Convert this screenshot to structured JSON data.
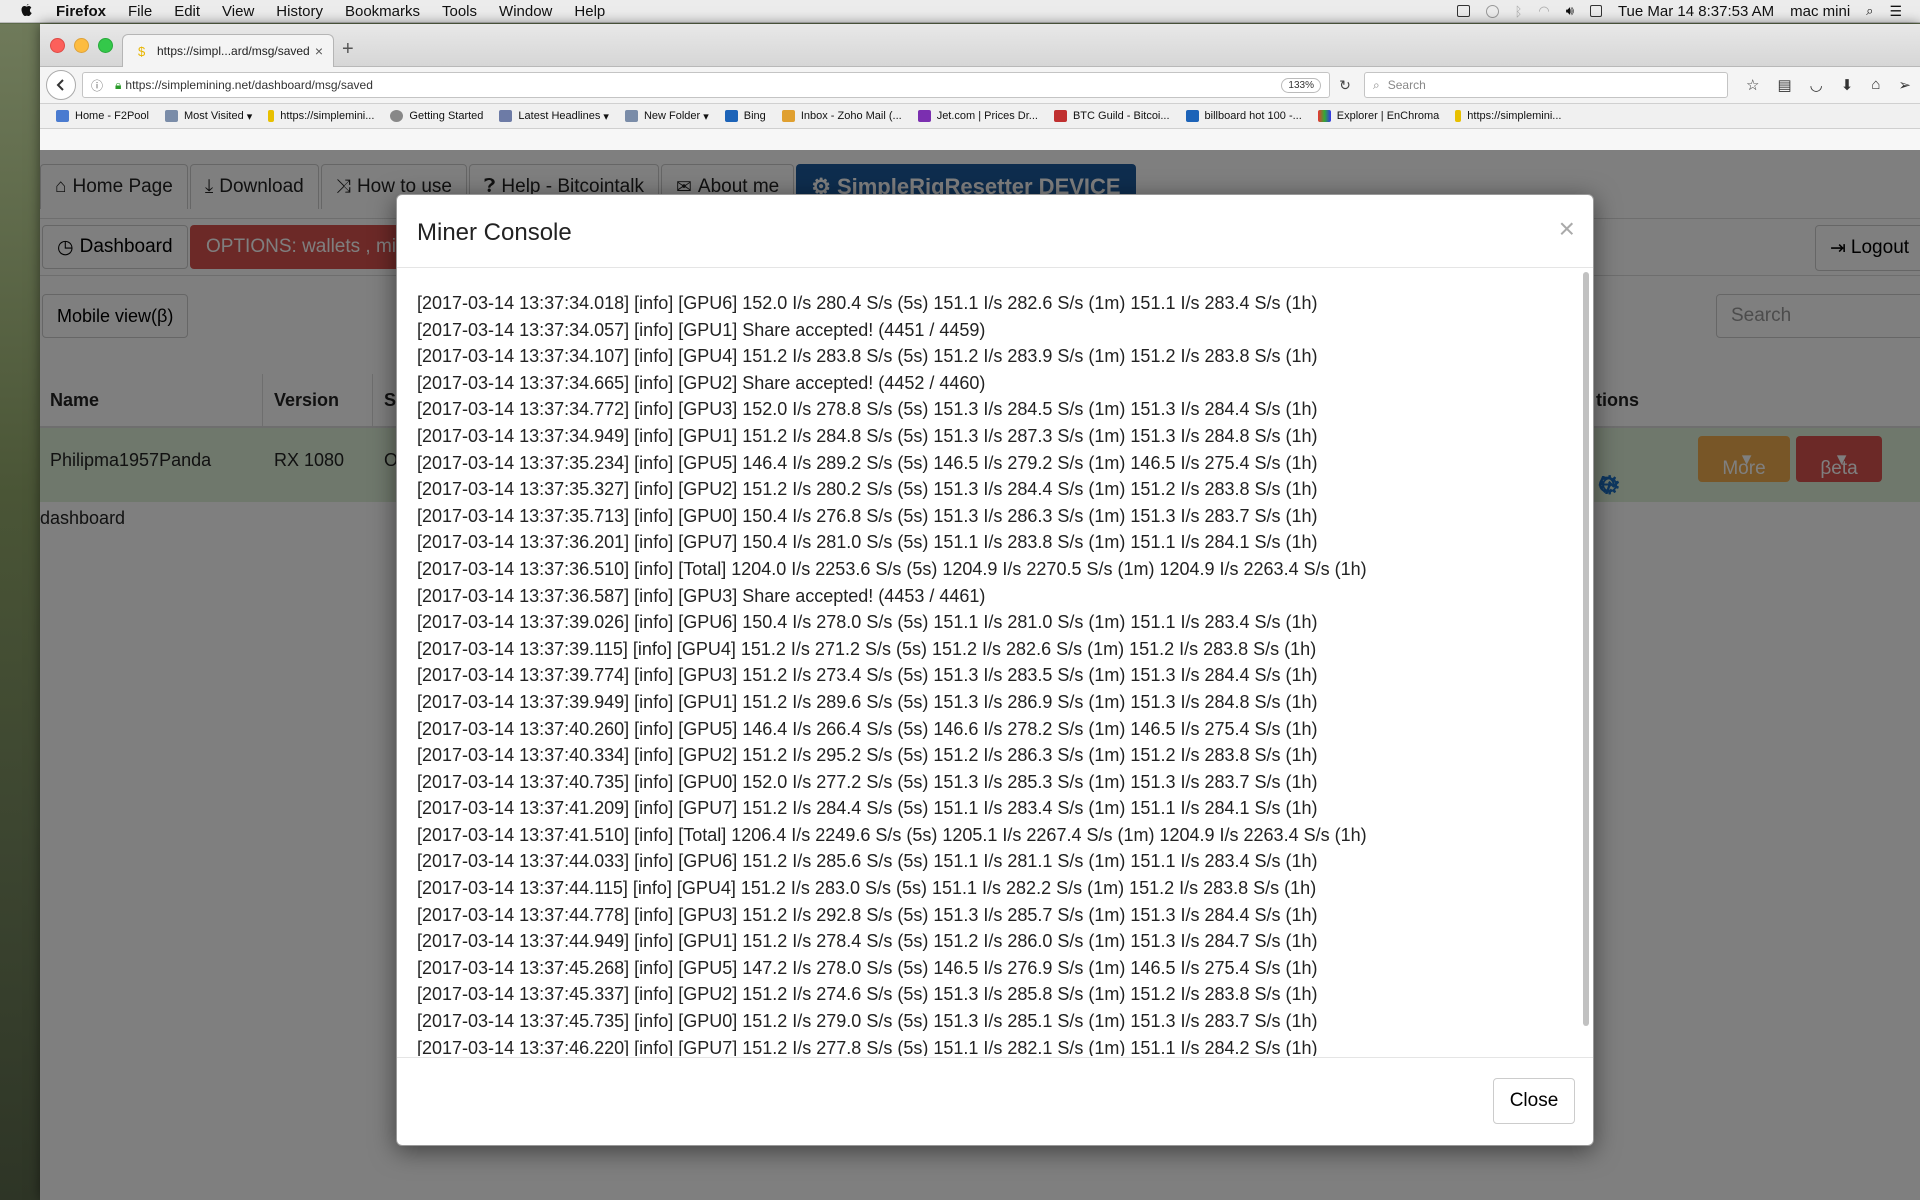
{
  "menubar": {
    "app": "Firefox",
    "items": [
      "File",
      "Edit",
      "View",
      "History",
      "Bookmarks",
      "Tools",
      "Window",
      "Help"
    ],
    "clock": "Tue Mar 14  8:37:53 AM",
    "user": "mac mini"
  },
  "browser": {
    "tab_title": "https://simpl...ard/msg/saved",
    "url": "https://simplemining.net/dashboard/msg/saved",
    "zoom": "133%",
    "search_placeholder": "Search",
    "bookmarks": [
      "Home - F2Pool",
      "Most Visited",
      "https://simplemini...",
      "Getting Started",
      "Latest Headlines",
      "New Folder",
      "Bing",
      "Inbox - Zoho Mail (...",
      "Jet.com | Prices Dr...",
      "BTC Guild - Bitcoi...",
      "billboard hot 100 -...",
      "Explorer | EnChroma",
      "https://simplemini..."
    ]
  },
  "page": {
    "nav": {
      "home": "Home Page",
      "download": "Download",
      "howto": "How to use",
      "help": "Help - Bitcointalk",
      "about": "About me",
      "device": "SimpleRigResetter DEVICE"
    },
    "dashboard_button": "Dashboard",
    "options_button": "OPTIONS: wallets , mi",
    "logout_button": "Logout",
    "mobile_button": "Mobile view(β)",
    "search_placeholder": "Search",
    "table": {
      "headers": {
        "name": "Name",
        "version": "Version",
        "s": "S",
        "actions": "tions"
      },
      "row": {
        "name": "Philipma1957Panda",
        "version": "RX 1080",
        "s": "O"
      },
      "more": "More",
      "beta": "βeta"
    },
    "footer_text": "dashboard"
  },
  "modal": {
    "title": "Miner Console",
    "close_label": "Close",
    "lines": [
      "[2017-03-14 13:37:34.018] [info] [GPU6] 152.0 I/s 280.4 S/s (5s) 151.1 I/s 282.6 S/s (1m) 151.1 I/s 283.4 S/s (1h)",
      "[2017-03-14 13:37:34.057] [info] [GPU1] Share accepted! (4451 / 4459)",
      "[2017-03-14 13:37:34.107] [info] [GPU4] 151.2 I/s 283.8 S/s (5s) 151.2 I/s 283.9 S/s (1m) 151.2 I/s 283.8 S/s (1h)",
      "[2017-03-14 13:37:34.665] [info] [GPU2] Share accepted! (4452 / 4460)",
      "[2017-03-14 13:37:34.772] [info] [GPU3] 152.0 I/s 278.8 S/s (5s) 151.3 I/s 284.5 S/s (1m) 151.3 I/s 284.4 S/s (1h)",
      "[2017-03-14 13:37:34.949] [info] [GPU1] 151.2 I/s 284.8 S/s (5s) 151.3 I/s 287.3 S/s (1m) 151.3 I/s 284.8 S/s (1h)",
      "[2017-03-14 13:37:35.234] [info] [GPU5] 146.4 I/s 289.2 S/s (5s) 146.5 I/s 279.2 S/s (1m) 146.5 I/s 275.4 S/s (1h)",
      "[2017-03-14 13:37:35.327] [info] [GPU2] 151.2 I/s 280.2 S/s (5s) 151.3 I/s 284.4 S/s (1m) 151.2 I/s 283.8 S/s (1h)",
      "[2017-03-14 13:37:35.713] [info] [GPU0] 150.4 I/s 276.8 S/s (5s) 151.3 I/s 286.3 S/s (1m) 151.3 I/s 283.7 S/s (1h)",
      "[2017-03-14 13:37:36.201] [info] [GPU7] 150.4 I/s 281.0 S/s (5s) 151.1 I/s 283.8 S/s (1m) 151.1 I/s 284.1 S/s (1h)",
      "[2017-03-14 13:37:36.510] [info] [Total] 1204.0 I/s 2253.6 S/s (5s) 1204.9 I/s 2270.5 S/s (1m) 1204.9 I/s 2263.4 S/s (1h)",
      "[2017-03-14 13:37:36.587] [info] [GPU3] Share accepted! (4453 / 4461)",
      "[2017-03-14 13:37:39.026] [info] [GPU6] 150.4 I/s 278.0 S/s (5s) 151.1 I/s 281.0 S/s (1m) 151.1 I/s 283.4 S/s (1h)",
      "[2017-03-14 13:37:39.115] [info] [GPU4] 151.2 I/s 271.2 S/s (5s) 151.2 I/s 282.6 S/s (1m) 151.2 I/s 283.8 S/s (1h)",
      "[2017-03-14 13:37:39.774] [info] [GPU3] 151.2 I/s 273.4 S/s (5s) 151.3 I/s 283.5 S/s (1m) 151.3 I/s 284.4 S/s (1h)",
      "[2017-03-14 13:37:39.949] [info] [GPU1] 151.2 I/s 289.6 S/s (5s) 151.3 I/s 286.9 S/s (1m) 151.3 I/s 284.8 S/s (1h)",
      "[2017-03-14 13:37:40.260] [info] [GPU5] 146.4 I/s 266.4 S/s (5s) 146.6 I/s 278.2 S/s (1m) 146.5 I/s 275.4 S/s (1h)",
      "[2017-03-14 13:37:40.334] [info] [GPU2] 151.2 I/s 295.2 S/s (5s) 151.2 I/s 286.3 S/s (1m) 151.2 I/s 283.8 S/s (1h)",
      "[2017-03-14 13:37:40.735] [info] [GPU0] 152.0 I/s 277.2 S/s (5s) 151.3 I/s 285.3 S/s (1m) 151.3 I/s 283.7 S/s (1h)",
      "[2017-03-14 13:37:41.209] [info] [GPU7] 151.2 I/s 284.4 S/s (5s) 151.1 I/s 283.4 S/s (1m) 151.1 I/s 284.1 S/s (1h)",
      "[2017-03-14 13:37:41.510] [info] [Total] 1206.4 I/s 2249.6 S/s (5s) 1205.1 I/s 2267.4 S/s (1m) 1204.9 I/s 2263.4 S/s (1h)",
      "[2017-03-14 13:37:44.033] [info] [GPU6] 151.2 I/s 285.6 S/s (5s) 151.1 I/s 281.1 S/s (1m) 151.1 I/s 283.4 S/s (1h)",
      "[2017-03-14 13:37:44.115] [info] [GPU4] 151.2 I/s 283.0 S/s (5s) 151.1 I/s 282.2 S/s (1m) 151.2 I/s 283.8 S/s (1h)",
      "[2017-03-14 13:37:44.778] [info] [GPU3] 151.2 I/s 292.8 S/s (5s) 151.3 I/s 285.7 S/s (1m) 151.3 I/s 284.4 S/s (1h)",
      "[2017-03-14 13:37:44.949] [info] [GPU1] 151.2 I/s 278.4 S/s (5s) 151.2 I/s 286.0 S/s (1m) 151.3 I/s 284.7 S/s (1h)",
      "[2017-03-14 13:37:45.268] [info] [GPU5] 147.2 I/s 278.0 S/s (5s) 146.5 I/s 276.9 S/s (1m) 146.5 I/s 275.4 S/s (1h)",
      "[2017-03-14 13:37:45.337] [info] [GPU2] 151.2 I/s 274.6 S/s (5s) 151.3 I/s 285.8 S/s (1m) 151.2 I/s 283.8 S/s (1h)",
      "[2017-03-14 13:37:45.735] [info] [GPU0] 151.2 I/s 279.0 S/s (5s) 151.3 I/s 285.1 S/s (1m) 151.3 I/s 283.7 S/s (1h)",
      "[2017-03-14 13:37:46.220] [info] [GPU7] 151.2 I/s 277.8 S/s (5s) 151.1 I/s 282.1 S/s (1m) 151.1 I/s 284.2 S/s (1h)"
    ]
  },
  "colors": {
    "device_tab": "#1d5a9c",
    "options_button": "#d9534f",
    "more_button": "#f0ad4e",
    "row_success": "#dff0d8"
  }
}
